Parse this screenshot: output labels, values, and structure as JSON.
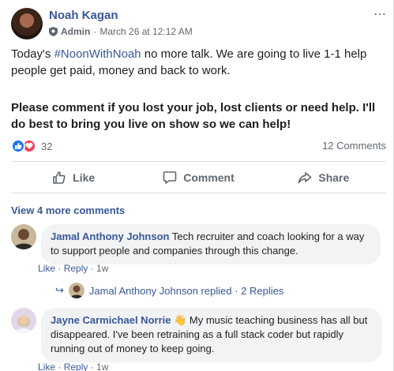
{
  "post": {
    "author": "Noah Kagan",
    "role": "Admin",
    "separator": "·",
    "timestamp": "March 26 at 12:12 AM",
    "more_icon": "⋯",
    "text_before_hashtag": "Today's ",
    "hashtag": "#NoonWithNoah",
    "text_after_hashtag": " no more talk. We are going to live 1-1 help people get paid, money and back to work.",
    "bold_text": "Please comment if you lost your job, lost clients or need help. I'll do best to bring you live on show so we can help!",
    "reaction_count": "32",
    "comments_count": "12 Comments"
  },
  "actions": {
    "like": "Like",
    "comment": "Comment",
    "share": "Share"
  },
  "view_more_comments": "View 4 more comments",
  "comments": [
    {
      "name": "Jamal Anthony Johnson",
      "text": " Tech recruiter and coach looking for a way to support people and companies through this change.",
      "like": "Like",
      "reply": "Reply",
      "time": "1w",
      "dot": " · "
    },
    {
      "name": "Jayne Carmichael Norrie",
      "emoji": "👋",
      "text": " My music teaching business has all but disappeared. I've been retraining as a full stack coder but rapidly running out of money to keep going.",
      "like": "Like",
      "reply": "Reply",
      "time": "1w",
      "dot": " · "
    }
  ],
  "reply_summary": {
    "arrow": "↪",
    "text": "Jamal Anthony Johnson replied · 2 Replies"
  },
  "colors": {
    "link_blue": "#385898",
    "like_blue": "#1877f2",
    "love_red": "#f33e58",
    "secondary_text": "#606770",
    "bubble_bg": "#f2f3f5"
  },
  "icons": {
    "admin": "shield-icon",
    "like_reaction": "thumbs-up-icon",
    "love_reaction": "heart-icon",
    "like_action": "thumbs-up-outline-icon",
    "comment_action": "speech-bubble-icon",
    "share_action": "share-arrow-icon",
    "reply_arrow": "reply-arrow-icon"
  }
}
